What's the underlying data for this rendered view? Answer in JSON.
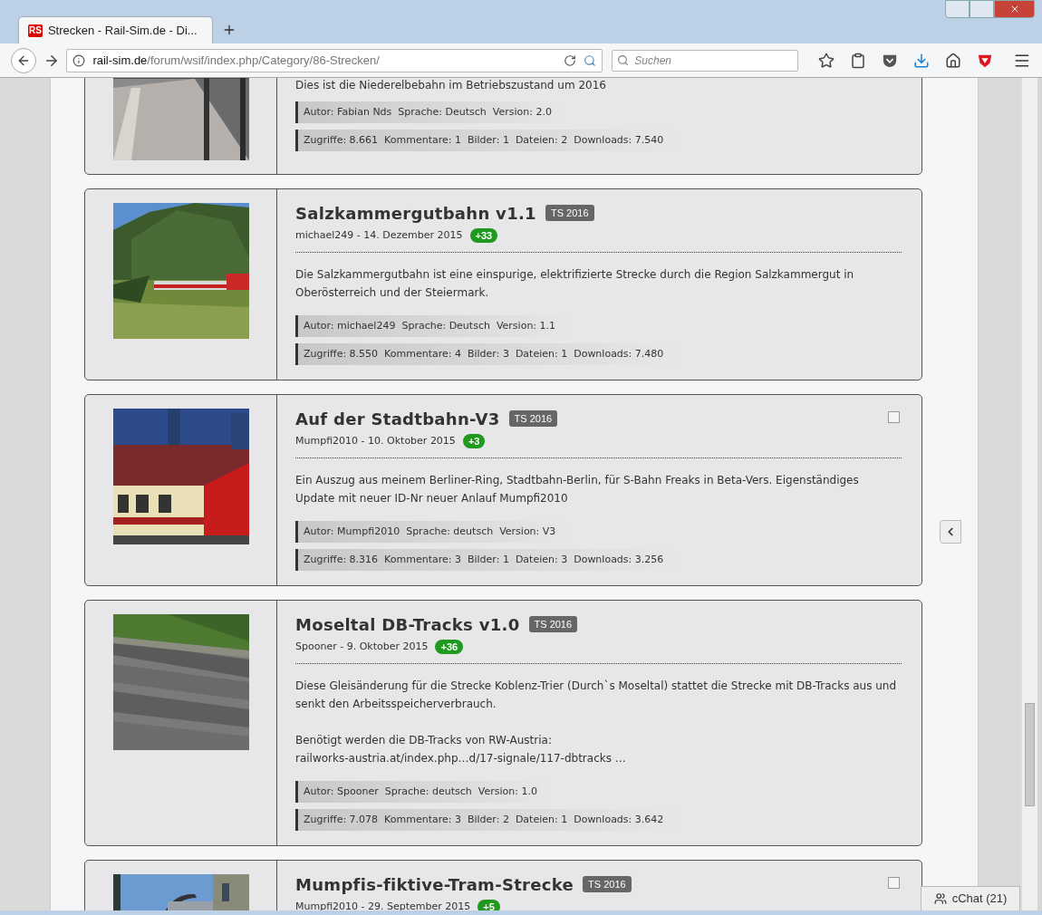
{
  "browser": {
    "site_logo": "RS",
    "tab_title": "Strecken - Rail-Sim.de - Di...",
    "url_domain": "rail-sim.de",
    "url_path": "/forum/wsif/index.php/Category/86-Strecken/",
    "search": {
      "placeholder": "Suchen"
    }
  },
  "entries": [
    {
      "description": [
        "Dies ist die Niederelbebahn im Betriebszustand um 2016"
      ],
      "info": [
        "Autor: Fabian Nds  Sprache: Deutsch  Version: 2.0",
        "Zugriffe: 8.661  Kommentare: 1  Bilder: 1  Dateien: 2  Downloads: 7.540"
      ],
      "picture": {
        "kind": "picture"
      }
    },
    {
      "title": "Salzkammergutbahn v1.1",
      "badge": "TS 2016",
      "meta": "michael249 - 14. Dezember 2015",
      "rating": "+33",
      "description": [
        "Die Salzkammergutbahn ist eine einspurige, elektrifizierte Strecke durch die Region Salzkammergut in Oberösterreich und der Steiermark."
      ],
      "info": [
        "Autor: michael249  Sprache: Deutsch  Version: 1.1",
        "Zugriffe: 8.550  Kommentare: 4  Bilder: 3  Dateien: 1  Downloads: 7.480"
      ],
      "picture": {
        "kind": "picture"
      }
    },
    {
      "title": "Auf der Stadtbahn-V3",
      "badge": "TS 2016",
      "meta": "Mumpfi2010 - 10. Oktober 2015",
      "rating": "+3",
      "checkbox": {
        "checked": false
      },
      "description": [
        "Ein Auszug aus meinem Berliner-Ring, Stadtbahn-Berlin, für S-Bahn Freaks in Beta-Vers. Eigenständiges Update mit neuer ID-Nr neuer Anlauf Mumpfi2010"
      ],
      "info": [
        "Autor: Mumpfi2010  Sprache: deutsch  Version: V3",
        "Zugriffe: 8.316  Kommentare: 3  Bilder: 1  Dateien: 3  Downloads: 3.256"
      ],
      "picture": {
        "kind": "picture"
      }
    },
    {
      "title": "Moseltal DB-Tracks v1.0",
      "badge": "TS 2016",
      "meta": "Spooner - 9. Oktober 2015",
      "rating": "+36",
      "description": [
        "Diese Gleisänderung für die Strecke Koblenz-Trier (Durch`s Moseltal) stattet die Strecke mit DB-Tracks aus und senkt den Arbeitsspeicherverbrauch.",
        "Benötigt werden die DB-Tracks von RW-Austria:\nrailworks-austria.at/index.php…d/17-signale/117-dbtracks …"
      ],
      "info": [
        "Autor: Spooner  Sprache: deutsch  Version: 1.0",
        "Zugriffe: 7.078  Kommentare: 3  Bilder: 2  Dateien: 1  Downloads: 3.642"
      ],
      "picture": {
        "kind": "picture"
      }
    },
    {
      "title": "Mumpfis-fiktive-Tram-Strecke",
      "badge": "TS 2016",
      "meta": "Mumpfi2010 - 29. September 2015",
      "rating": "+5",
      "checkbox": {
        "checked": false
      },
      "picture": {
        "kind": "picture"
      }
    }
  ],
  "chat_button": "cChat (21)"
}
